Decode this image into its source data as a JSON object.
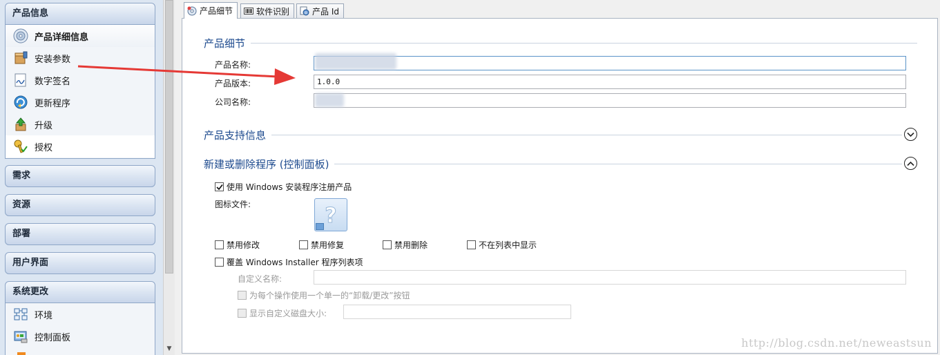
{
  "sidebar": {
    "groups": [
      {
        "label": "产品信息",
        "items": [
          {
            "label": "产品详细信息",
            "icon": "disc-info-icon"
          },
          {
            "label": "安装参数",
            "icon": "install-box-icon"
          },
          {
            "label": "数字签名",
            "icon": "signature-icon"
          },
          {
            "label": "更新程序",
            "icon": "update-icon"
          },
          {
            "label": "升级",
            "icon": "upgrade-icon"
          },
          {
            "label": "授权",
            "icon": "license-key-icon"
          }
        ]
      },
      {
        "label": "需求"
      },
      {
        "label": "资源"
      },
      {
        "label": "部署"
      },
      {
        "label": "用户界面"
      },
      {
        "label": "系统更改",
        "items": [
          {
            "label": "环境",
            "icon": "environment-icon"
          },
          {
            "label": "控制面板",
            "icon": "control-panel-icon"
          }
        ]
      }
    ]
  },
  "tabs": [
    {
      "label": "产品细节",
      "icon": "disc-icon",
      "active": true
    },
    {
      "label": "软件识别",
      "icon": "barcode-icon",
      "active": false
    },
    {
      "label": "产品 Id",
      "icon": "product-id-icon",
      "active": false
    }
  ],
  "product_details": {
    "title": "产品细节",
    "name_label": "产品名称:",
    "name_value": "",
    "version_label": "产品版本:",
    "version_value": "1.0.0",
    "company_label": "公司名称:",
    "company_value": ""
  },
  "support": {
    "title": "产品支持信息"
  },
  "control_panel": {
    "title": "新建或删除程序 (控制面板)",
    "register_label": "使用 Windows 安装程序注册产品",
    "icon_file_label": "图标文件:",
    "disable_modify": "禁用修改",
    "disable_repair": "禁用修复",
    "disable_remove": "禁用删除",
    "hide_in_list": "不在列表中显示",
    "override_label": "覆盖 Windows Installer 程序列表项",
    "custom_name_label": "自定义名称:",
    "single_button_label": "为每个操作使用一个单一的“卸载/更改”按钮",
    "custom_disk_label": "显示自定义磁盘大小:"
  },
  "watermark": "http://blog.csdn.net/neweastsun",
  "colors": {
    "section_title": "#1d4a8e",
    "annotation_arrow": "#e53935"
  }
}
